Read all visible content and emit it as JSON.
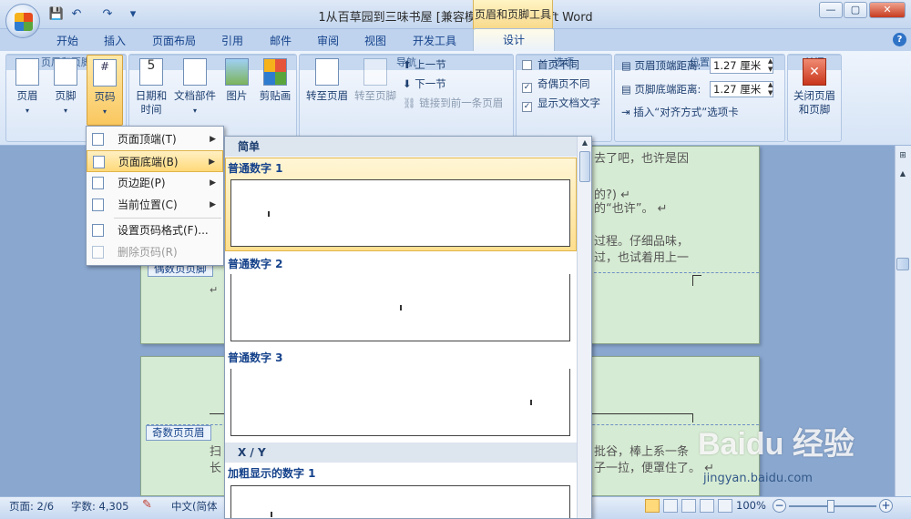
{
  "window": {
    "title": "1从百草园到三味书屋 [兼容模式] - Microsoft Word",
    "context_tab_title": "页眉和页脚工具",
    "min_glyph": "—",
    "max_glyph": "▢",
    "close_glyph": "✕"
  },
  "qat": {
    "save": "💾",
    "undo": "↶",
    "redo": "↷",
    "customize": "▾"
  },
  "tabs": [
    "开始",
    "插入",
    "页面布局",
    "引用",
    "邮件",
    "审阅",
    "视图",
    "开发工具",
    "设计"
  ],
  "help_glyph": "?",
  "ribbon": {
    "header": {
      "label": "页眉"
    },
    "footer": {
      "label": "页脚"
    },
    "page_number": {
      "label": "页码"
    },
    "group_header_footer": "页眉和页脚",
    "date_time": {
      "line1": "日期和",
      "line2": "时间"
    },
    "doc_parts": {
      "label": "文档部件"
    },
    "picture": {
      "label": "图片"
    },
    "clipart": {
      "label": "剪贴画"
    },
    "goto_header": {
      "label": "转至页眉"
    },
    "goto_footer": {
      "label": "转至页脚"
    },
    "prev_section": "上一节",
    "next_section": "下一节",
    "link_prev": "链接到前一条页眉",
    "group_nav": "导航",
    "opt_first_page": "首页不同",
    "opt_odd_even": "奇偶页不同",
    "opt_show_text": "显示文档文字",
    "group_options": "选项",
    "header_distance_label": "页眉顶端距离:",
    "header_distance_value": "1.27 厘米",
    "footer_distance_label": "页脚底端距离:",
    "footer_distance_value": "1.27 厘米",
    "insert_align_tab": "插入“对齐方式”选项卡",
    "group_position": "位置",
    "close": {
      "line1": "关闭页眉",
      "line2": "和页脚"
    },
    "group_close": "关闭"
  },
  "menu": {
    "items": [
      {
        "label": "页面顶端(T)"
      },
      {
        "label": "页面底端(B)"
      },
      {
        "label": "页边距(P)"
      },
      {
        "label": "当前位置(C)"
      },
      {
        "label": "设置页码格式(F)..."
      },
      {
        "label": "删除页码(R)"
      }
    ]
  },
  "gallery": {
    "section_simple": "简单",
    "item1": "普通数字 1",
    "item2": "普通数字 2",
    "item3": "普通数字 3",
    "section_xy": "X / Y",
    "item4": "加粗显示的数字 1"
  },
  "doc": {
    "line1": "去了吧，也许是因",
    "line2": "的?) ↵",
    "line3": "的“也许”。 ↵",
    "line4": "过程。仔细品味，",
    "line5": "过，也试着用上一",
    "odd_footer_label": "偶数页页脚",
    "odd_header_label": "奇数页页眉",
    "line6": "批谷，棒上系一条",
    "line7": "子一拉，便罩住了。 ↵",
    "left_frag1": "扫",
    "left_frag2": "长",
    "para_mark": "↵"
  },
  "status": {
    "page": "页面: 2/6",
    "words": "字数: 4,305",
    "lang": "中文(简体",
    "zoom": "100%",
    "zoom_minus": "−",
    "zoom_plus": "+"
  },
  "watermark": {
    "brand": "Baidu 经验",
    "url": "jingyan.baidu.com"
  }
}
